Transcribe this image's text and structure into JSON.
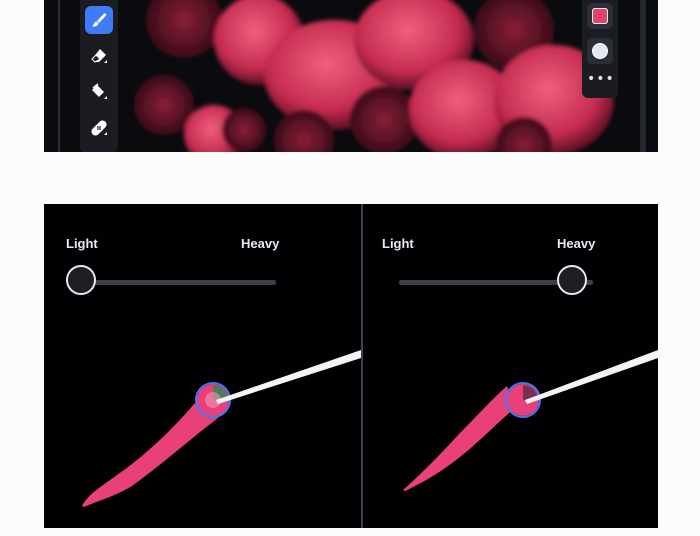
{
  "top_app": {
    "tools": [
      "brush-tool",
      "eraser-tool",
      "fill-tool",
      "healing-tool"
    ],
    "colors": {
      "accent": "#3e7bf5",
      "swatch_primary": "#e8416c",
      "swatch_secondary": "#e6e6ee"
    },
    "more_label": "•••"
  },
  "pressure_demo": {
    "left_panel": {
      "label_light": "Light",
      "label_heavy": "Heavy",
      "pressure": 0.0
    },
    "right_panel": {
      "label_light": "Light",
      "label_heavy": "Heavy",
      "pressure": 1.0
    },
    "colors": {
      "stroke": "#e9407a",
      "cursor_ring": "#3e7bf5",
      "pen": "#f4f4f4"
    }
  }
}
